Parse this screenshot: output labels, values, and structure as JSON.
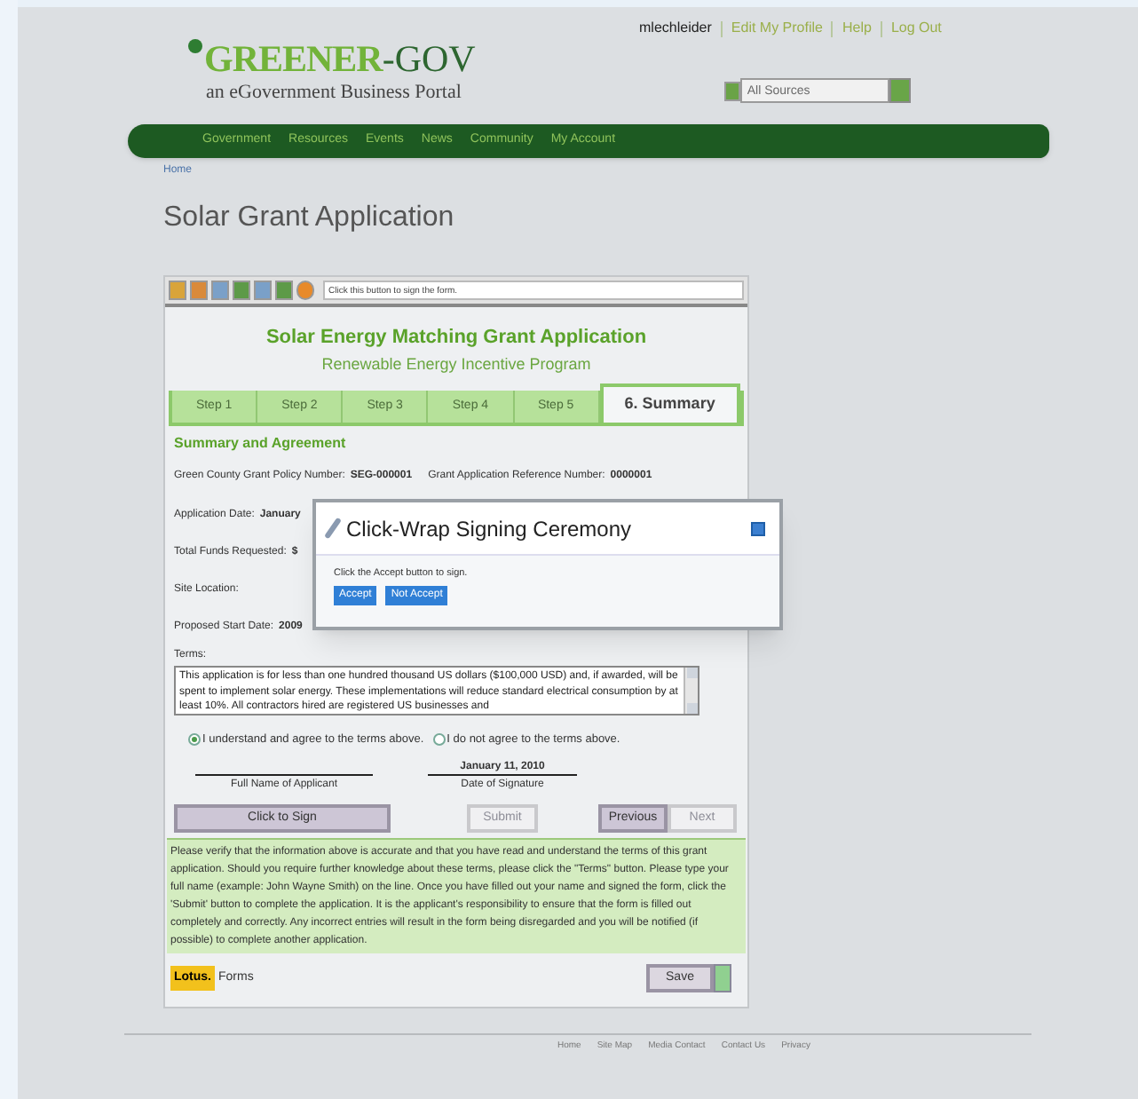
{
  "user_links": [
    {
      "label": "mlechleider",
      "kind": "user"
    },
    {
      "label": "Edit My Profile",
      "kind": "link"
    },
    {
      "label": "Help",
      "kind": "link"
    },
    {
      "label": "Log Out",
      "kind": "link"
    }
  ],
  "logo": {
    "name_a": "GREENER",
    "name_b": "-GOV",
    "tagline": "an eGovernment Business Portal"
  },
  "search": {
    "placeholder": "All Sources"
  },
  "nav": [
    "Government",
    "Resources",
    "Events",
    "News",
    "Community",
    "My Account"
  ],
  "breadcrumb": "Home",
  "page_title": "Solar Grant Application",
  "toolbar": {
    "hint": "Click this button to sign the form."
  },
  "form": {
    "title": "Solar Energy Matching Grant Application",
    "subtitle": "Renewable Energy Incentive Program",
    "tabs": [
      {
        "label": "Step 1",
        "selected": false
      },
      {
        "label": "Step 2",
        "selected": false
      },
      {
        "label": "Step 3",
        "selected": false
      },
      {
        "label": "Step 4",
        "selected": false
      },
      {
        "label": "Step 5",
        "selected": false
      },
      {
        "label": "6. Summary",
        "selected": true
      }
    ],
    "section": "Summary and Agreement",
    "policy": {
      "label": "Green County Grant Policy Number:",
      "value": "SEG-000001"
    },
    "reference": {
      "label": "Grant Application Reference Number:",
      "value": "0000001"
    },
    "fields": [
      {
        "label": "Application Date:",
        "value": "January"
      },
      {
        "label": "Total Funds Requested:",
        "value": "$"
      },
      {
        "label": "Site Location:"
      },
      {
        "label": "Proposed Start Date:",
        "value": "2009"
      }
    ],
    "terms_label": "Terms:",
    "terms": "This application is for less than one hundred thousand US dollars ($100,000 USD) and, if awarded, will be spent to implement solar energy. These implementations will reduce standard electrical consumption by at least 10%. All contractors hired are registered US businesses and",
    "options": [
      {
        "label": "I understand and agree to the terms above.",
        "selected": true
      },
      {
        "label": "I do not agree to the terms above.",
        "selected": false
      }
    ],
    "signature": {
      "name_label": "Full Name of Applicant",
      "date": "January 11, 2010",
      "date_label": "Date of Signature"
    },
    "buttons": [
      {
        "label": "Click to Sign",
        "disabled": false
      },
      {
        "label": "Submit",
        "disabled": true
      },
      {
        "label": "Previous",
        "disabled": false
      },
      {
        "label": "Next",
        "disabled": true
      }
    ],
    "instructions": "Please verify that the information above is accurate and that you have read and understand the terms of this grant application. Should you require further knowledge about these terms, please click the \"Terms\" button. Please type your full name (example: John Wayne Smith) on the line. Once you have filled out your name and signed the form, click the 'Submit' button to complete the application. It is the applicant's responsibility to ensure that the form is filled out completely and correctly. Any incorrect entries will result in the form being disregarded and you will be notified (if possible) to complete another application.",
    "brand": {
      "badge": "Lotus.",
      "text": "Forms"
    },
    "save": "Save"
  },
  "dialog": {
    "title": "Click-Wrap Signing Ceremony",
    "message": "Click the Accept button to sign.",
    "buttons": [
      "Accept",
      "Not Accept"
    ]
  },
  "footer_links": [
    "Home",
    "Site Map",
    "Media Contact",
    "Contact Us",
    "Privacy"
  ]
}
